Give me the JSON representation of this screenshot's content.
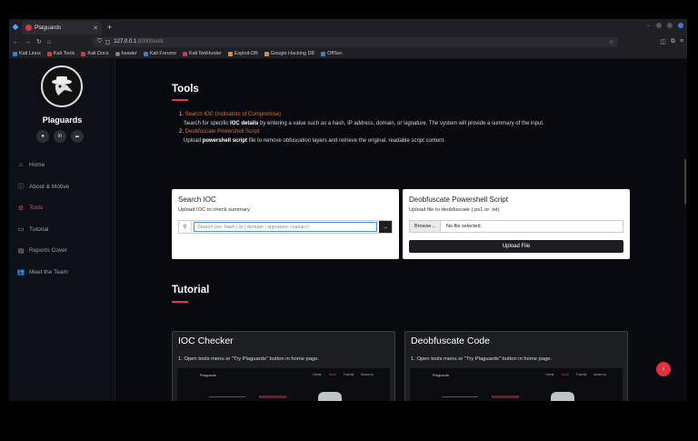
{
  "browser": {
    "tab_title": "Plaguards",
    "new_tab": "+",
    "url_host": "127.0.0.1",
    "url_path": ":8000/tools",
    "bookmarks": [
      "Kali Linux",
      "Kali Tools",
      "Kali Docs",
      "header",
      "Kali Forums",
      "Kali NetHunter",
      "Exploit-DB",
      "Google Hacking DB",
      "OffSec"
    ]
  },
  "sidebar": {
    "brand": "Plaguards",
    "items": [
      {
        "label": "Home",
        "icon": "home-icon"
      },
      {
        "label": "About & Motive",
        "icon": "info-icon"
      },
      {
        "label": "Tools",
        "icon": "tools-icon",
        "active": true
      },
      {
        "label": "Tutorial",
        "icon": "tutorial-icon"
      },
      {
        "label": "Reports Cover",
        "icon": "report-icon"
      },
      {
        "label": "Meet the Team",
        "icon": "team-icon"
      }
    ]
  },
  "tools": {
    "heading": "Tools",
    "item1_link": "Search IOC (Indicators of Compromise)",
    "item1_pre": "Search for specific ",
    "item1_bold": "IOC details",
    "item1_post": " by entering a value such as a hash, IP address, domain, or signature. The system will provide a summary of the input.",
    "item2_link": "Deobfuscate Powershell Script",
    "item2_pre": "Upload ",
    "item2_bold": "powershell script",
    "item2_post": " file to remove obfuscation layers and retrieve the original, readable script content."
  },
  "search_ioc": {
    "title": "Search IOC",
    "subtitle": "Upload IOC to check summary",
    "placeholder": "Search (ex: hash | ip | domain | signature <value>)",
    "go": "→"
  },
  "deobfuscate": {
    "title": "Deobfuscate Powershell Script",
    "subtitle": "Upload file to deobfuscate (.ps1 or .txt)",
    "browse": "Browse...",
    "no_file": "No file selected.",
    "upload": "Upload File"
  },
  "tutorial": {
    "heading": "Tutorial",
    "cards": [
      {
        "title": "IOC Checker",
        "step": "1. Open tools menu or \"Try Plaguards\" button in home page."
      },
      {
        "title": "Deobfuscate Code",
        "step": "1. Open tools menu or \"Try Plaguards\" button in home page."
      }
    ],
    "shot_brand": "Plaguards",
    "shot_nav": [
      "Home",
      "Tools",
      "Tutorial",
      "About us"
    ]
  },
  "colors": {
    "accent": "#e23b47",
    "link": "#e36b3a",
    "bg": "#080a0f"
  }
}
